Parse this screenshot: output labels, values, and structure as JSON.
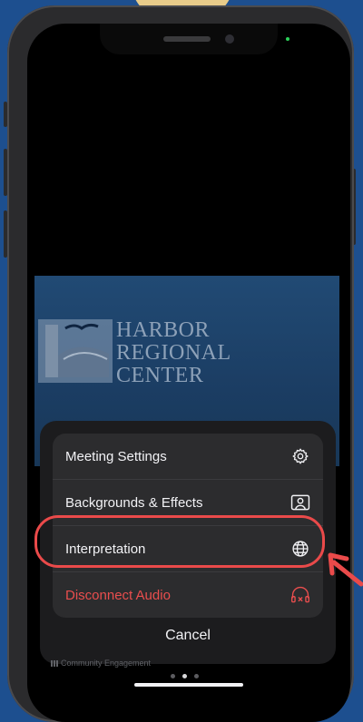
{
  "video": {
    "logo_lines": [
      "HARBOR",
      "REGIONAL",
      "CENTER"
    ]
  },
  "menu": {
    "items": [
      {
        "label": "Meeting Settings",
        "icon": "gear-icon"
      },
      {
        "label": "Backgrounds & Effects",
        "icon": "person-frame-icon"
      },
      {
        "label": "Interpretation",
        "icon": "globe-icon"
      },
      {
        "label": "Disconnect Audio",
        "icon": "headphones-disconnect-icon"
      }
    ],
    "cancel_label": "Cancel"
  },
  "footer": {
    "text": "Community Engagement"
  },
  "colors": {
    "background": "#1d4f8f",
    "sheet": "#1c1c1e",
    "menu_group": "#2c2c2e",
    "danger": "#ea4e4e",
    "highlight": "#ea4a4a"
  }
}
